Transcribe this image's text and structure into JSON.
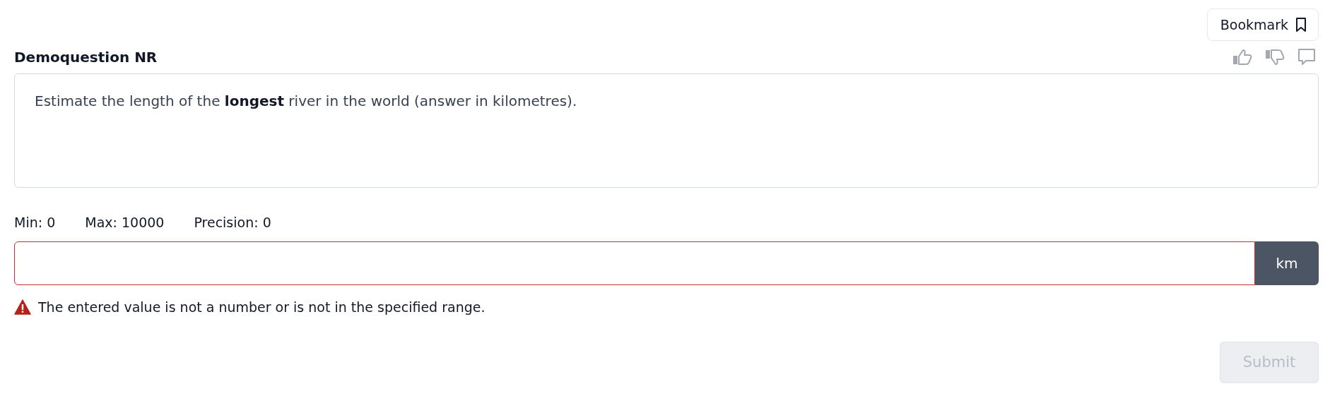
{
  "bookmark": {
    "label": "Bookmark"
  },
  "question": {
    "title": "Demoquestion NR",
    "text": "Estimate the length of the **longest** river in the world (answer in kilometres)."
  },
  "constraints": [
    "Min: 0",
    "Max: 10000",
    "Precision: 0"
  ],
  "answer": {
    "unit": "km",
    "invalid": true
  },
  "error": "The entered value is not a number or is not in the specified range.",
  "submit": {
    "label": "Submit",
    "disabled": true
  }
}
